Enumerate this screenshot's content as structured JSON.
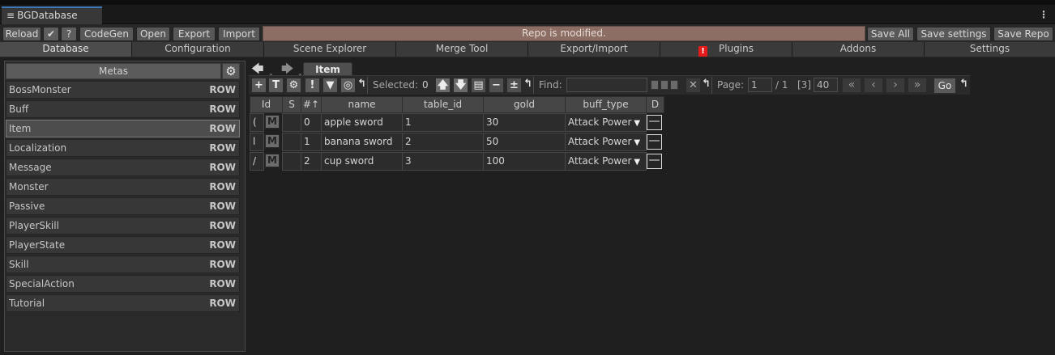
{
  "window": {
    "title": "BGDatabase",
    "menu_icon": "hamburger-icon",
    "kebab_icon": "kebab-icon"
  },
  "toolbar": {
    "reload": "Reload",
    "codegen": "CodeGen",
    "open": "Open",
    "export": "Export",
    "import": "Import",
    "status": "Repo is modified.",
    "save_all": "Save All",
    "save_settings": "Save settings",
    "save_repo": "Save Repo"
  },
  "tabs": [
    "Database",
    "Configuration",
    "Scene Explorer",
    "Merge Tool",
    "Export/Import",
    "Plugins",
    "Addons",
    "Settings"
  ],
  "warning_glyph": "!",
  "metas": {
    "header": "Metas",
    "row_tag": "ROW",
    "items": [
      "BossMonster",
      "Buff",
      "Item",
      "Localization",
      "Message",
      "Monster",
      "Passive",
      "PlayerSkill",
      "PlayerState",
      "Skill",
      "SpecialAction",
      "Tutorial"
    ],
    "selected": "Item"
  },
  "table": {
    "tab": "Item",
    "selected_label": "Selected:",
    "selected_count": "0",
    "find_label": "Find:",
    "find_value": "",
    "page_label": "Page:",
    "page_value": "1",
    "page_total": "/ 1",
    "count": "[3]",
    "page_size": "40",
    "go": "Go",
    "columns": [
      "Id",
      "S",
      "#↑",
      "name",
      "table_id",
      "gold",
      "buff_type",
      "D"
    ],
    "rows": [
      {
        "id": "(",
        "m": "M",
        "num": "0",
        "name": "apple sword",
        "table_id": "1",
        "gold": "30",
        "buff_type": "Attack Power"
      },
      {
        "id": "l",
        "m": "M",
        "num": "1",
        "name": "banana sword",
        "table_id": "2",
        "gold": "50",
        "buff_type": "Attack Power"
      },
      {
        "id": "/",
        "m": "M",
        "num": "2",
        "name": "cup sword",
        "table_id": "3",
        "gold": "100",
        "buff_type": "Attack Power"
      }
    ]
  }
}
